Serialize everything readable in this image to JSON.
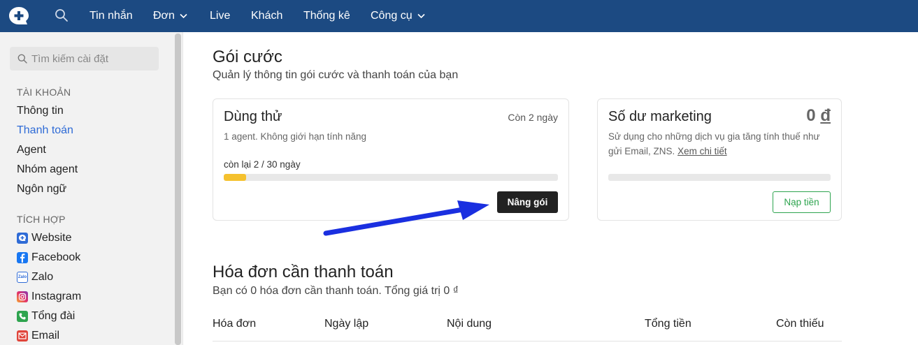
{
  "topbar": {
    "nav": [
      {
        "label": "Tin nhắn"
      },
      {
        "label": "Đơn"
      },
      {
        "label": "Live"
      },
      {
        "label": "Khách"
      },
      {
        "label": "Thống kê"
      },
      {
        "label": "Công cụ"
      }
    ]
  },
  "sidebar": {
    "search_placeholder": "Tìm kiếm cài đặt",
    "section_account": "TÀI KHOẢN",
    "account_items": [
      "Thông tin",
      "Thanh toán",
      "Agent",
      "Nhóm agent",
      "Ngôn ngữ"
    ],
    "section_integration": "TÍCH HỢP",
    "integration_items": [
      "Website",
      "Facebook",
      "Zalo",
      "Instagram",
      "Tổng đài",
      "Email"
    ],
    "zalo_icon_text": "Zalo"
  },
  "main": {
    "title": "Gói cước",
    "subtitle": "Quản lý thông tin gói cước và thanh toán của bạn",
    "plan_card": {
      "title": "Dùng thử",
      "days_left": "Còn 2 ngày",
      "description": "1 agent. Không giới hạn tính năng",
      "progress_label": "còn lại 2 / 30 ngày",
      "progress_fraction": 0.067,
      "upgrade_button": "Nâng gói"
    },
    "marketing_card": {
      "title": "Số dư marketing",
      "balance": "0",
      "currency": "đ",
      "description_line1": "Sử dụng cho những dịch vụ gia tăng tính thuế như",
      "description_line2": "gửi Email, ZNS.",
      "details_link": "Xem chi tiết",
      "progress_fraction": 0,
      "topup_button": "Nạp tiền"
    },
    "invoices": {
      "title": "Hóa đơn cần thanh toán",
      "subtitle": "Bạn có 0 hóa đơn cần thanh toán. Tổng giá trị 0 ₫",
      "columns": [
        "Hóa đơn",
        "Ngày lập",
        "Nội dung",
        "Tổng tiền",
        "Còn thiếu"
      ]
    }
  },
  "colors": {
    "topbar": "#1c4a82",
    "accent_blue": "#2f6bd6",
    "progress_yellow": "#f5c12e",
    "green": "#2ea44f",
    "arrow_blue": "#1a2fe0"
  }
}
